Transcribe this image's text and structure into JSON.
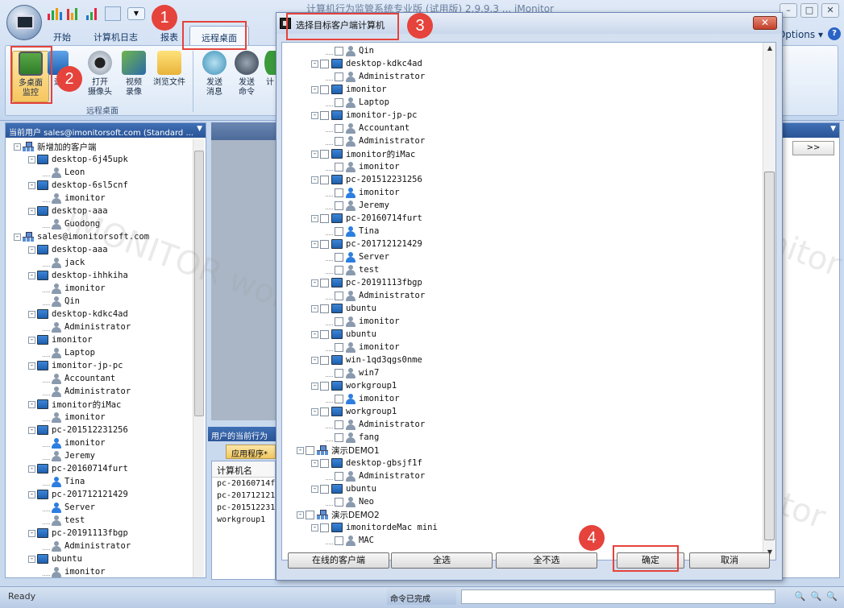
{
  "app": {
    "title_text": "计算机行为监管系统专业版 (试用版) 2.9.9.3 ... iMonitor",
    "options_label": "Options",
    "help_label": "?"
  },
  "tabs": [
    "开始",
    "计算机日志",
    "报表",
    "远程桌面"
  ],
  "ribbon": {
    "buttons": [
      {
        "label": "多桌面\n监控",
        "icon": "monitor-icon"
      },
      {
        "label": "远",
        "icon": "screen-icon"
      },
      {
        "label": "打开\n摄像头",
        "icon": "webcam-icon"
      },
      {
        "label": "视频\n录像",
        "icon": "video-icon"
      },
      {
        "label": "浏览文件",
        "icon": "folder-icon"
      },
      {
        "label": "发送\n消息",
        "icon": "message-icon"
      },
      {
        "label": "发送\n命令",
        "icon": "command-icon"
      },
      {
        "label": "计",
        "icon": "computer-icon"
      }
    ],
    "group_label": "远程桌面"
  },
  "left_panel": {
    "header": "当前用户 sales@imonitorsoft.com (Standard ...",
    "tree": [
      {
        "level": 0,
        "type": "group",
        "label": "新增加的客户端",
        "expand": "-"
      },
      {
        "level": 1,
        "type": "pc",
        "label": "desktop-6j45upk",
        "expand": "-"
      },
      {
        "level": 2,
        "type": "user",
        "label": "Leon",
        "online": false
      },
      {
        "level": 1,
        "type": "pc",
        "label": "desktop-6sl5cnf",
        "expand": "-"
      },
      {
        "level": 2,
        "type": "user",
        "label": "imonitor",
        "online": false
      },
      {
        "level": 1,
        "type": "pc",
        "label": "desktop-aaa",
        "expand": "-"
      },
      {
        "level": 2,
        "type": "user",
        "label": "Guodong",
        "online": false
      },
      {
        "level": 0,
        "type": "group",
        "label": "sales@imonitorsoft.com",
        "expand": "-"
      },
      {
        "level": 1,
        "type": "pc",
        "label": "desktop-aaa",
        "expand": "-"
      },
      {
        "level": 2,
        "type": "user",
        "label": "jack",
        "online": false
      },
      {
        "level": 1,
        "type": "pc",
        "label": "desktop-ihhkiha",
        "expand": "-"
      },
      {
        "level": 2,
        "type": "user",
        "label": "imonitor",
        "online": false
      },
      {
        "level": 2,
        "type": "user",
        "label": "Qin",
        "online": false
      },
      {
        "level": 1,
        "type": "pc",
        "label": "desktop-kdkc4ad",
        "expand": "-"
      },
      {
        "level": 2,
        "type": "user",
        "label": "Administrator",
        "online": false
      },
      {
        "level": 1,
        "type": "pc",
        "label": "imonitor",
        "expand": "-"
      },
      {
        "level": 2,
        "type": "user",
        "label": "Laptop",
        "online": false
      },
      {
        "level": 1,
        "type": "pc",
        "label": "imonitor-jp-pc",
        "expand": "-"
      },
      {
        "level": 2,
        "type": "user",
        "label": "Accountant",
        "online": false
      },
      {
        "level": 2,
        "type": "user",
        "label": "Administrator",
        "online": false
      },
      {
        "level": 1,
        "type": "pc",
        "label": "imonitor的iMac",
        "expand": "-"
      },
      {
        "level": 2,
        "type": "user",
        "label": "imonitor",
        "online": false
      },
      {
        "level": 1,
        "type": "pc",
        "label": "pc-201512231256",
        "expand": "-"
      },
      {
        "level": 2,
        "type": "user",
        "label": "imonitor",
        "online": true
      },
      {
        "level": 2,
        "type": "user",
        "label": "Jeremy",
        "online": false
      },
      {
        "level": 1,
        "type": "pc",
        "label": "pc-20160714furt",
        "expand": "-"
      },
      {
        "level": 2,
        "type": "user",
        "label": "Tina",
        "online": true
      },
      {
        "level": 1,
        "type": "pc",
        "label": "pc-201712121429",
        "expand": "-"
      },
      {
        "level": 2,
        "type": "user",
        "label": "Server",
        "online": true
      },
      {
        "level": 2,
        "type": "user",
        "label": "test",
        "online": false
      },
      {
        "level": 1,
        "type": "pc",
        "label": "pc-20191113fbgp",
        "expand": "-"
      },
      {
        "level": 2,
        "type": "user",
        "label": "Administrator",
        "online": false
      },
      {
        "level": 1,
        "type": "pc",
        "label": "ubuntu",
        "expand": "-"
      },
      {
        "level": 2,
        "type": "user",
        "label": "imonitor",
        "online": false
      }
    ]
  },
  "behavior_panel": {
    "header": "用户的当前行为",
    "tab": "应用程序*",
    "column": "计算机名",
    "rows": [
      "pc-20160714f",
      "pc-201712121",
      "pc-201512231",
      "workgroup1"
    ]
  },
  "right_panel": {
    "next_label": ">>"
  },
  "status": {
    "left": "Ready",
    "cmd": "命令已完成"
  },
  "dialog": {
    "title": "选择目标客户端计算机",
    "close_label": "✕",
    "tree": [
      {
        "level": 2,
        "type": "user",
        "label": "Qin",
        "online": false
      },
      {
        "level": 1,
        "type": "pc",
        "label": "desktop-kdkc4ad",
        "expand": "-"
      },
      {
        "level": 2,
        "type": "user",
        "label": "Administrator",
        "online": false
      },
      {
        "level": 1,
        "type": "pc",
        "label": "imonitor",
        "expand": "-"
      },
      {
        "level": 2,
        "type": "user",
        "label": "Laptop",
        "online": false
      },
      {
        "level": 1,
        "type": "pc",
        "label": "imonitor-jp-pc",
        "expand": "-"
      },
      {
        "level": 2,
        "type": "user",
        "label": "Accountant",
        "online": false
      },
      {
        "level": 2,
        "type": "user",
        "label": "Administrator",
        "online": false
      },
      {
        "level": 1,
        "type": "pc",
        "label": "imonitor的iMac",
        "expand": "-"
      },
      {
        "level": 2,
        "type": "user",
        "label": "imonitor",
        "online": false
      },
      {
        "level": 1,
        "type": "pc",
        "label": "pc-201512231256",
        "expand": "-"
      },
      {
        "level": 2,
        "type": "user",
        "label": "imonitor",
        "online": true
      },
      {
        "level": 2,
        "type": "user",
        "label": "Jeremy",
        "online": false
      },
      {
        "level": 1,
        "type": "pc",
        "label": "pc-20160714furt",
        "expand": "-"
      },
      {
        "level": 2,
        "type": "user",
        "label": "Tina",
        "online": true
      },
      {
        "level": 1,
        "type": "pc",
        "label": "pc-201712121429",
        "expand": "-"
      },
      {
        "level": 2,
        "type": "user",
        "label": "Server",
        "online": true
      },
      {
        "level": 2,
        "type": "user",
        "label": "test",
        "online": false
      },
      {
        "level": 1,
        "type": "pc",
        "label": "pc-20191113fbgp",
        "expand": "-"
      },
      {
        "level": 2,
        "type": "user",
        "label": "Administrator",
        "online": false
      },
      {
        "level": 1,
        "type": "pc",
        "label": "ubuntu",
        "expand": "-"
      },
      {
        "level": 2,
        "type": "user",
        "label": "imonitor",
        "online": false
      },
      {
        "level": 1,
        "type": "pc",
        "label": "ubuntu",
        "expand": "-"
      },
      {
        "level": 2,
        "type": "user",
        "label": "imonitor",
        "online": false
      },
      {
        "level": 1,
        "type": "pc",
        "label": "win-1qd3qgs0nme",
        "expand": "-"
      },
      {
        "level": 2,
        "type": "user",
        "label": "win7",
        "online": false
      },
      {
        "level": 1,
        "type": "pc",
        "label": "workgroup1",
        "expand": "-"
      },
      {
        "level": 2,
        "type": "user",
        "label": "imonitor",
        "online": true
      },
      {
        "level": 1,
        "type": "pc",
        "label": "workgroup1",
        "expand": "-"
      },
      {
        "level": 2,
        "type": "user",
        "label": "Administrator",
        "online": false
      },
      {
        "level": 2,
        "type": "user",
        "label": "fang",
        "online": false
      },
      {
        "level": 0,
        "type": "group",
        "label": "演示DEMO1",
        "expand": "-"
      },
      {
        "level": 1,
        "type": "pc",
        "label": "desktop-gbsjf1f",
        "expand": "-"
      },
      {
        "level": 2,
        "type": "user",
        "label": "Administrator",
        "online": false
      },
      {
        "level": 1,
        "type": "pc",
        "label": "ubuntu",
        "expand": "-"
      },
      {
        "level": 2,
        "type": "user",
        "label": "Neo",
        "online": false
      },
      {
        "level": 0,
        "type": "group",
        "label": "演示DEMO2",
        "expand": "-"
      },
      {
        "level": 1,
        "type": "pc",
        "label": "imonitordeMac mini",
        "expand": "-"
      },
      {
        "level": 2,
        "type": "user",
        "label": "MAC",
        "online": false
      }
    ],
    "buttons": {
      "online": "在线的客户端",
      "select_all": "全选",
      "select_none": "全不选",
      "ok": "确定",
      "cancel": "取消"
    }
  },
  "steps": [
    "1",
    "2",
    "3",
    "4"
  ],
  "watermark": [
    "group1 CONFIDENTIAL imonitor",
    "IMONITOR workgroup1 CONFIDENTIAL",
    "CONFIDENTIAL imonitor"
  ],
  "colors": {
    "annotation": "#e5433b",
    "header_blue": "#2b5597",
    "online_user": "#2c7ee0"
  }
}
